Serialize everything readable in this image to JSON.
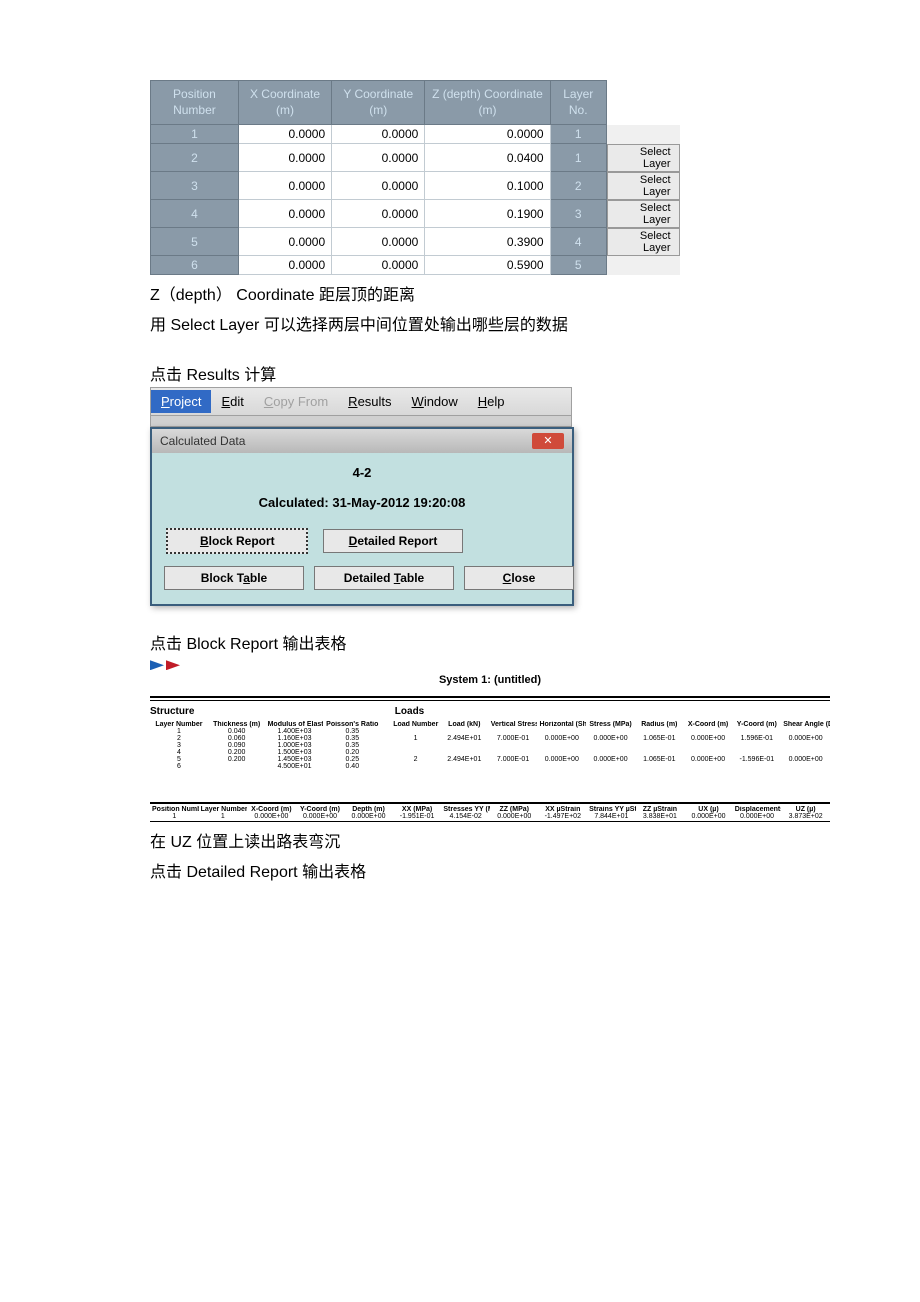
{
  "positions_table": {
    "headers": {
      "pos": "Position\nNumber",
      "x": "X\nCoordinate\n(m)",
      "y": "Y\nCoordinate\n(m)",
      "z": "Z (depth)\nCoordinate\n(m)",
      "layer": "Layer\nNo."
    },
    "rows": [
      {
        "pos": "1",
        "x": "0.0000",
        "y": "0.0000",
        "z": "0.0000",
        "layer": "1",
        "btn": ""
      },
      {
        "pos": "2",
        "x": "0.0000",
        "y": "0.0000",
        "z": "0.0400",
        "layer": "1",
        "btn": "Select Layer"
      },
      {
        "pos": "3",
        "x": "0.0000",
        "y": "0.0000",
        "z": "0.1000",
        "layer": "2",
        "btn": "Select Layer"
      },
      {
        "pos": "4",
        "x": "0.0000",
        "y": "0.0000",
        "z": "0.1900",
        "layer": "3",
        "btn": "Select Layer"
      },
      {
        "pos": "5",
        "x": "0.0000",
        "y": "0.0000",
        "z": "0.3900",
        "layer": "4",
        "btn": "Select Layer"
      },
      {
        "pos": "6",
        "x": "0.0000",
        "y": "0.0000",
        "z": "0.5900",
        "layer": "5",
        "btn": ""
      }
    ]
  },
  "notes": {
    "n1": "Z（depth） Coordinate  距层顶的距离",
    "n2": "用 Select Layer 可以选择两层中间位置处输出哪些层的数据",
    "n3": "点击 Results 计算",
    "n4": "点击 Block Report 输出表格",
    "n5": "在 UZ 位置上读出路表弯沉",
    "n6": "点击 Detailed Report 输出表格"
  },
  "menubar": {
    "project": "Project",
    "edit": "Edit",
    "copy": "Copy From",
    "results": "Results",
    "window": "Window",
    "help": "Help"
  },
  "dialog": {
    "title": "Calculated Data",
    "name": "4-2",
    "status": "Calculated: 31-May-2012 19:20:08",
    "buttons": {
      "breport": "Block Report",
      "dreport": "Detailed Report",
      "btable": "Block Table",
      "dtable": "Detailed Table",
      "close": "Close"
    }
  },
  "report": {
    "title": "System 1: (untitled)",
    "structure_heading": "Structure",
    "loads_heading": "Loads",
    "structure": {
      "headers": {
        "layer": "Layer\nNumber",
        "thk": "Thickness\n(m)",
        "mod": "Modulus of\nElasticity\n(MPa)",
        "pr": "Poisson's\nRatio"
      },
      "rows": [
        {
          "layer": "1",
          "thk": "0.040",
          "mod": "1.400E+03",
          "pr": "0.35"
        },
        {
          "layer": "2",
          "thk": "0.060",
          "mod": "1.160E+03",
          "pr": "0.35"
        },
        {
          "layer": "3",
          "thk": "0.090",
          "mod": "1.000E+03",
          "pr": "0.35"
        },
        {
          "layer": "4",
          "thk": "0.200",
          "mod": "1.500E+03",
          "pr": "0.20"
        },
        {
          "layer": "5",
          "thk": "0.200",
          "mod": "1.450E+03",
          "pr": "0.25"
        },
        {
          "layer": "6",
          "thk": "",
          "mod": "4.500E+01",
          "pr": "0.40"
        }
      ]
    },
    "loads": {
      "headers": {
        "ln": "Load\nNumber",
        "load": "Load\n(kN)",
        "vstr": "Vertical\nStress\n(MPa)",
        "hld": "Horizontal (Shear)\nLoad\n(kN)",
        "hstr": "Stress\n(MPa)",
        "rad": "Radius\n(m)",
        "xc": "X-Coord\n(m)",
        "yc": "Y-Coord\n(m)",
        "sang": "Shear\nAngle\n(Degrees)"
      },
      "rows": [
        {
          "ln": "1",
          "load": "2.494E+01",
          "vstr": "7.000E-01",
          "hld": "0.000E+00",
          "hstr": "0.000E+00",
          "rad": "1.065E-01",
          "xc": "0.000E+00",
          "yc": "1.596E-01",
          "sang": "0.000E+00"
        },
        {
          "ln": "2",
          "load": "2.494E+01",
          "vstr": "7.000E-01",
          "hld": "0.000E+00",
          "hstr": "0.000E+00",
          "rad": "1.065E-01",
          "xc": "0.000E+00",
          "yc": "-1.596E-01",
          "sang": "0.000E+00"
        }
      ]
    },
    "results": {
      "headers": {
        "pn": "Position\nNumber",
        "ln": "Layer\nNumber",
        "xc": "X-Coord\n(m)",
        "yc": "Y-Coord\n(m)",
        "dep": "Depth\n(m)",
        "sxx": "XX\n(MPa)",
        "syy": "Stresses\nYY\n(MPa)",
        "szz": "ZZ\n(MPa)",
        "exx": "XX\nµStrain",
        "eyy": "Strains\nYY\nµStrain",
        "ezz": "ZZ\nµStrain",
        "ux": "UX\n(µ)",
        "uy": "Displacements\nUY\n(µ)",
        "uz": "UZ\n(µ)"
      },
      "rows": [
        {
          "pn": "1",
          "ln": "1",
          "xc": "0.000E+00",
          "yc": "0.000E+00",
          "dep": "0.000E+00",
          "sxx": "-1.951E-01",
          "syy": "4.154E-02",
          "szz": "0.000E+00",
          "exx": "-1.497E+02",
          "eyy": "7.844E+01",
          "ezz": "3.838E+01",
          "ux": "0.000E+00",
          "uy": "0.000E+00",
          "uz": "3.873E+02"
        }
      ]
    }
  }
}
